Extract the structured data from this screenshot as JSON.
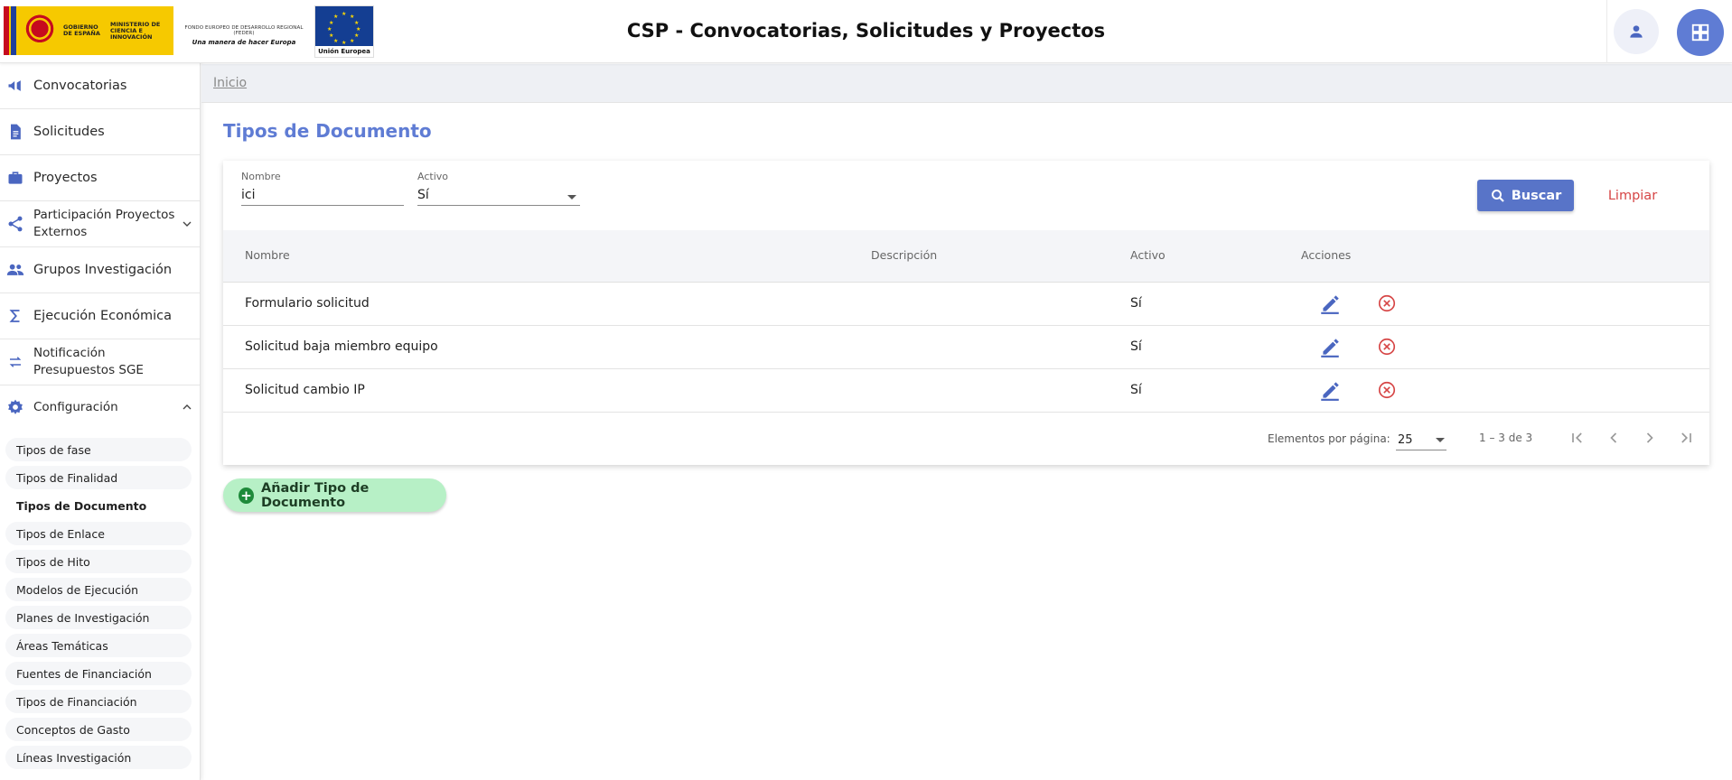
{
  "header": {
    "gov_line1": "GOBIERNO DE ESPAÑA",
    "gov_line2": "MINISTERIO DE CIENCIA E INNOVACIÓN",
    "feder_line1": "FONDO EUROPEO DE DESARROLLO REGIONAL (FEDER)",
    "feder_line2": "Una manera de hacer Europa",
    "eu_label": "Unión Europea",
    "title": "CSP - Convocatorias, Solicitudes y Proyectos",
    "user_icon": "person-icon",
    "apps_icon": "grid-icon",
    "accent_color": "#5f7cd4"
  },
  "sidebar": {
    "items": [
      {
        "label": "Convocatorias",
        "icon": "megaphone-icon"
      },
      {
        "label": "Solicitudes",
        "icon": "document-icon"
      },
      {
        "label": "Proyectos",
        "icon": "briefcase-icon"
      },
      {
        "label": "Participación Proyectos Externos",
        "icon": "share-icon"
      },
      {
        "label": "Grupos Investigación",
        "icon": "group-icon"
      },
      {
        "label": "Ejecución Económica",
        "icon": "sigma-icon"
      },
      {
        "label": "Notificación Presupuestos SGE",
        "icon": "swap-icon"
      },
      {
        "label": "Configuración",
        "icon": "gear-icon"
      }
    ],
    "config_submenu": [
      "Tipos de fase",
      "Tipos de Finalidad",
      "Tipos de Documento",
      "Tipos de Enlace",
      "Tipos de Hito",
      "Modelos de Ejecución",
      "Planes de Investigación",
      "Áreas Temáticas",
      "Fuentes de Financiación",
      "Tipos de Financiación",
      "Conceptos de Gasto",
      "Líneas Investigación"
    ],
    "active_submenu": "Tipos de Documento"
  },
  "breadcrumb": "Inicio",
  "page_title": "Tipos de Documento",
  "filters": {
    "nombre_label": "Nombre",
    "nombre_value": "ici",
    "activo_label": "Activo",
    "activo_value": "Sí",
    "search_button": "Buscar",
    "clear_button": "Limpiar"
  },
  "table": {
    "headers": [
      "Nombre",
      "Descripción",
      "Activo",
      "Acciones"
    ],
    "rows": [
      {
        "nombre": "Formulario solicitud",
        "descripcion": "",
        "activo": "Sí"
      },
      {
        "nombre": "Solicitud baja miembro equipo",
        "descripcion": "",
        "activo": "Sí"
      },
      {
        "nombre": "Solicitud cambio IP",
        "descripcion": "",
        "activo": "Sí"
      }
    ]
  },
  "paginator": {
    "items_per_page_label": "Elementos por página:",
    "items_per_page": "25",
    "range": "1 – 3 de 3"
  },
  "add_button": "Añadir Tipo de Documento",
  "colors": {
    "primary": "#5874c8",
    "danger": "#d64545",
    "add_bg": "#b7f0c6",
    "add_icon": "#1e8a3a"
  }
}
